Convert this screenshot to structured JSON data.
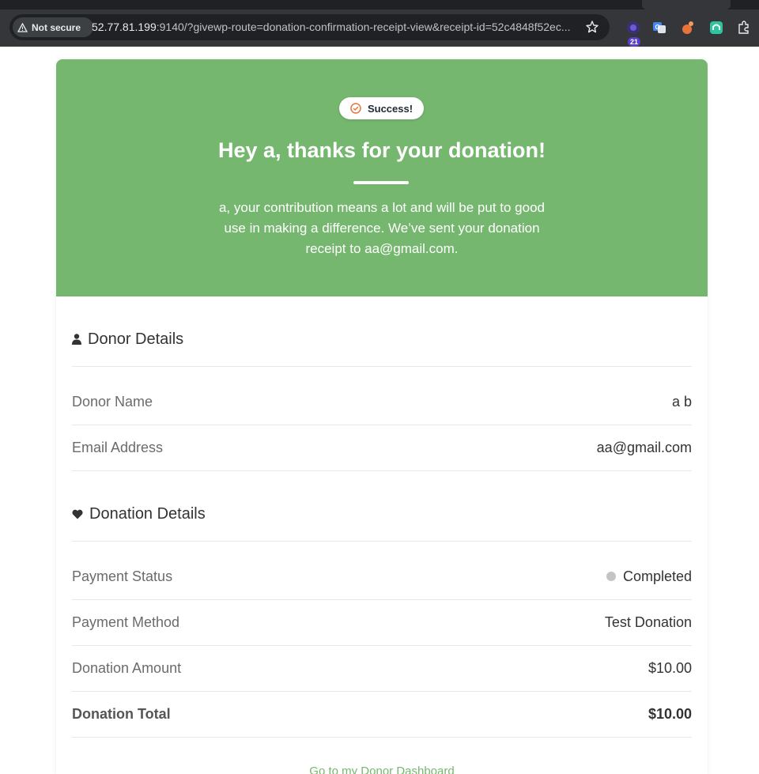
{
  "browser": {
    "security_label": "Not secure",
    "url_host": "52.77.81.199",
    "url_rest": ":9140/?givewp-route=donation-confirmation-receipt-view&receipt-id=52c4848f52ec...",
    "extension_badge": "21"
  },
  "hero": {
    "badge_label": "Success!",
    "title": "Hey a, thanks for your donation!",
    "message": "a, your contribution means a lot and will be put to good use in making a difference. We’ve sent your donation receipt to aa@gmail.com.",
    "background_color": "#76b770"
  },
  "donor_section": {
    "heading": "Donor Details",
    "rows": [
      {
        "label": "Donor Name",
        "value": "a b"
      },
      {
        "label": "Email Address",
        "value": "aa@gmail.com"
      }
    ]
  },
  "donation_section": {
    "heading": "Donation Details",
    "rows": [
      {
        "label": "Payment Status",
        "value": "Completed"
      },
      {
        "label": "Payment Method",
        "value": "Test Donation"
      },
      {
        "label": "Donation Amount",
        "value": "$10.00"
      },
      {
        "label": "Donation Total",
        "value": "$10.00"
      }
    ]
  },
  "footer": {
    "dashboard_link": "Go to my Donor Dashboard"
  }
}
